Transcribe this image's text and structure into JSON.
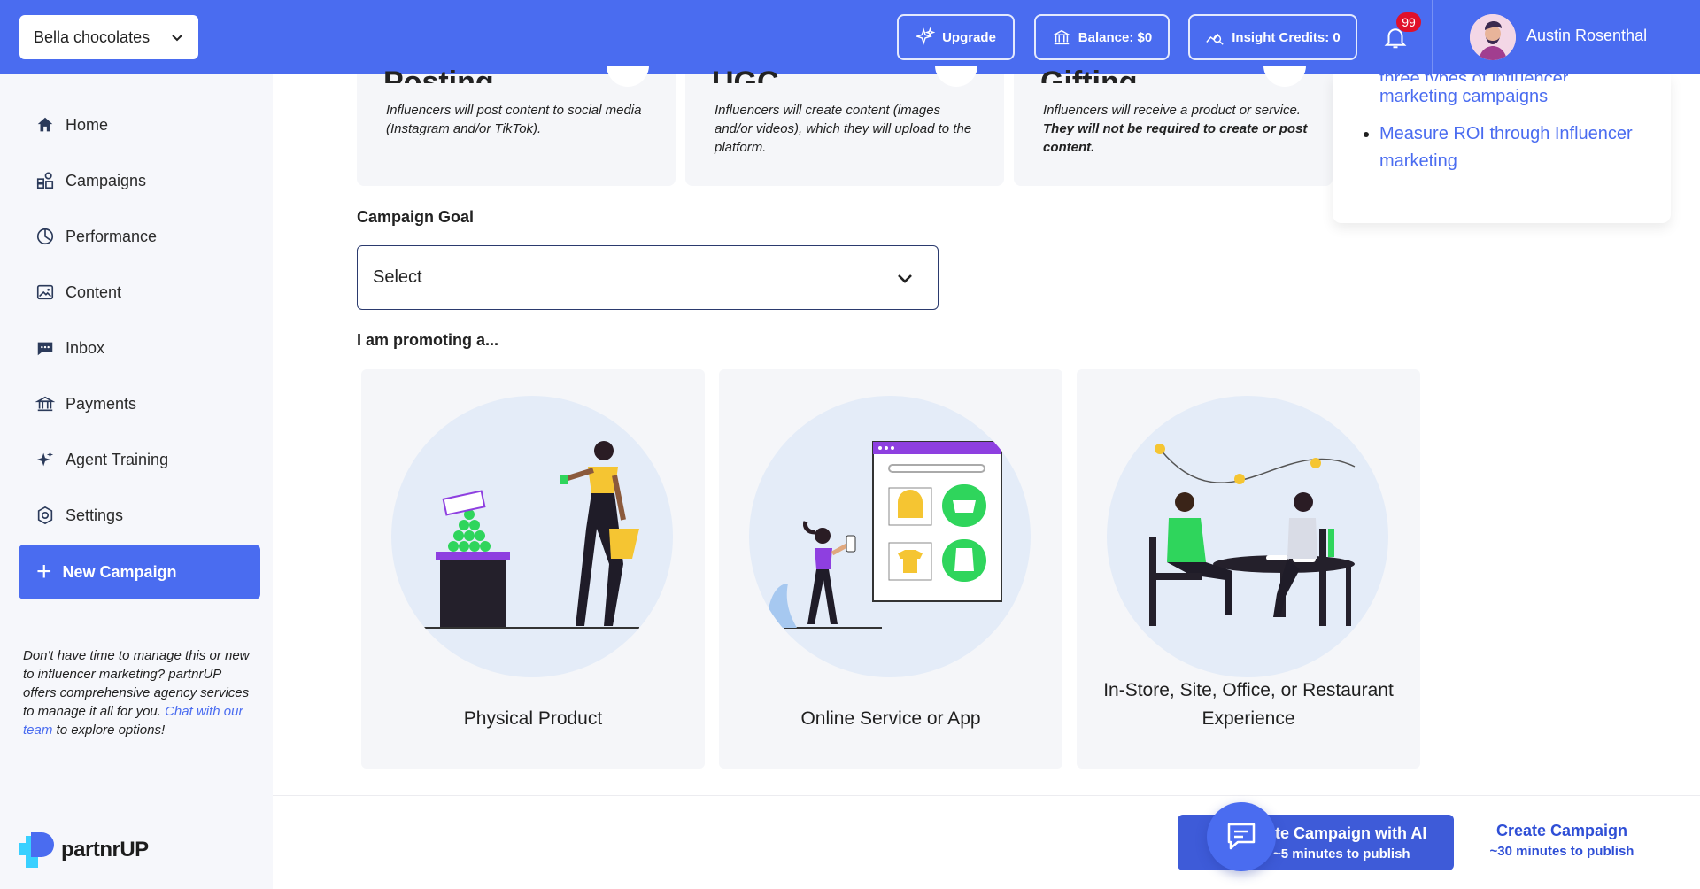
{
  "header": {
    "brand_select": "Bella chocolates",
    "upgrade_label": "Upgrade",
    "balance_label": "Balance: $0",
    "credits_label": "Insight Credits: 0",
    "notification_count": "99",
    "user_name": "Austin Rosenthal"
  },
  "sidebar": {
    "items": [
      {
        "label": "Home",
        "icon": "home-icon"
      },
      {
        "label": "Campaigns",
        "icon": "campaigns-icon"
      },
      {
        "label": "Performance",
        "icon": "pie-chart-icon"
      },
      {
        "label": "Content",
        "icon": "image-icon"
      },
      {
        "label": "Inbox",
        "icon": "chat-icon"
      },
      {
        "label": "Payments",
        "icon": "bank-icon"
      },
      {
        "label": "Agent Training",
        "icon": "sparkle-icon"
      },
      {
        "label": "Settings",
        "icon": "gear-icon"
      }
    ],
    "new_campaign_label": "New Campaign",
    "note_text": "Don't have time to manage this or new to influencer marketing? partnrUP offers comprehensive agency services to manage it all for you.",
    "note_link": "Chat with our team",
    "note_tail": "to explore options!",
    "logo_text": "partnrUP"
  },
  "campaign_types": [
    {
      "title": "Posting",
      "desc": "Influencers will post content to social media (Instagram and/or TikTok).",
      "desc_bold": ""
    },
    {
      "title": "UGC",
      "desc": "Influencers will create content (images and/or videos), which they will upload to the platform.",
      "desc_bold": ""
    },
    {
      "title": "Gifting",
      "desc": "Influencers will receive a product or service. ",
      "desc_bold": "They will not be required to create or post content."
    }
  ],
  "help": {
    "peek": "three types of influencer",
    "items": [
      "marketing campaigns",
      "Measure ROI through Influencer marketing"
    ]
  },
  "form": {
    "goal_label": "Campaign Goal",
    "goal_value": "Select",
    "promo_label": "I am promoting a..."
  },
  "promo_options": [
    {
      "title": "Physical Product"
    },
    {
      "title": "Online Service or App"
    },
    {
      "title": "In-Store, Site, Office, or Restaurant Experience"
    }
  ],
  "footer": {
    "ai_title": "te Campaign with AI",
    "ai_sub": "~5 minutes to publish",
    "create_title": "Create Campaign",
    "create_sub": "~30 minutes to publish"
  },
  "colors": {
    "primary": "#4a6cf0",
    "card_bg": "#f5f6f9",
    "badge": "#e0102a"
  }
}
